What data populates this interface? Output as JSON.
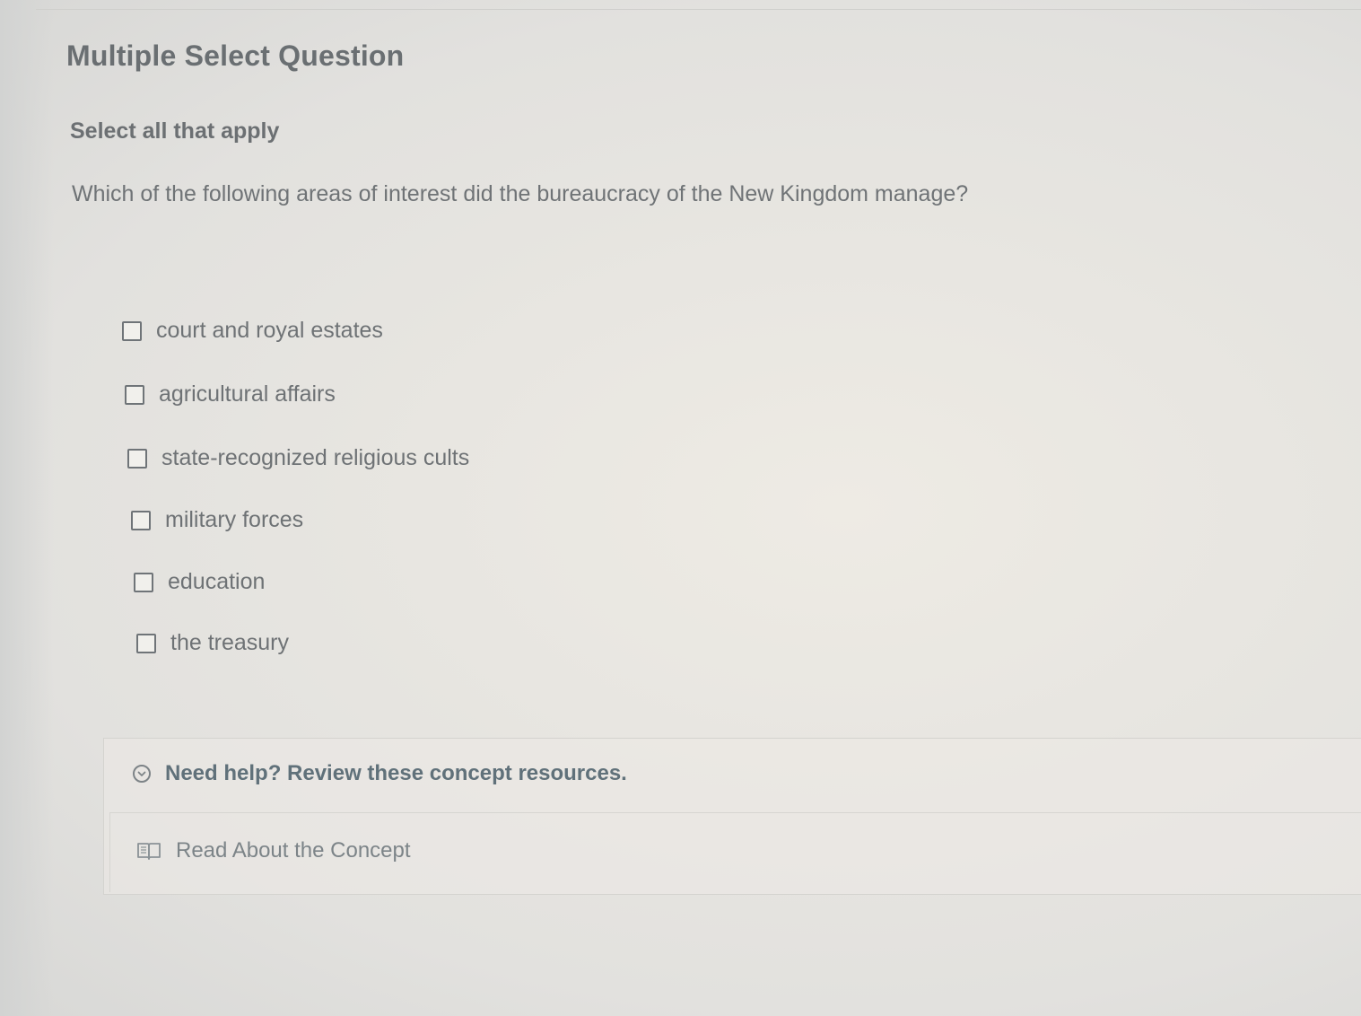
{
  "question": {
    "type_title": "Multiple Select Question",
    "instruction": "Select all that apply",
    "prompt": "Which of the following areas of interest did the bureaucracy of the New Kingdom manage?"
  },
  "options": [
    {
      "label": "court and royal estates",
      "checked": false
    },
    {
      "label": "agricultural affairs",
      "checked": false
    },
    {
      "label": "state-recognized religious cults",
      "checked": false
    },
    {
      "label": "military forces",
      "checked": false
    },
    {
      "label": "education",
      "checked": false
    },
    {
      "label": "the treasury",
      "checked": false
    }
  ],
  "help": {
    "toggle_label": "Need help? Review these concept resources.",
    "toggle_icon": "chevron-down-circle-icon",
    "resource_label": "Read About the Concept",
    "resource_icon": "book-icon"
  }
}
